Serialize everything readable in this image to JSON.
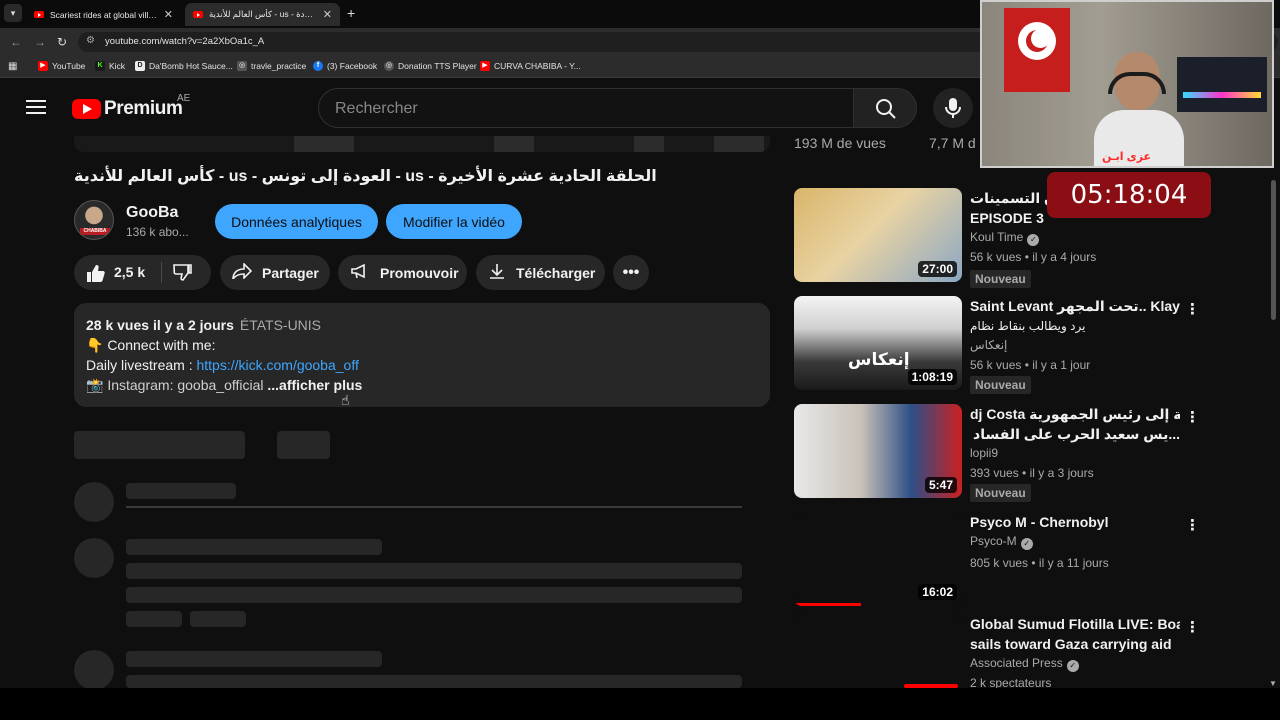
{
  "browser": {
    "tabs": [
      {
        "title": "Scariest rides at global village -",
        "active": false
      },
      {
        "title": "كأس العالم للأندية - us - العودة ||",
        "active": true
      }
    ],
    "url": "youtube.com/watch?v=2a2XbOa1c_A",
    "bookmarks": [
      "YouTube",
      "Kick",
      "Da'Bomb Hot Sauce...",
      "travle_practice",
      "(3) Facebook",
      "Donation TTS Player",
      "CURVA CHABIBA - Y..."
    ]
  },
  "header": {
    "logo_text": "Premium",
    "region": "AE",
    "search_placeholder": "Rechercher"
  },
  "video": {
    "title": "الحلقة الحادية عشرة الأخيرة - us - العودة إلى تونس - us - كأس العالم للأندية",
    "channel_name": "GooBa",
    "channel_subs": "136 k abo...",
    "avatar_tag": "CHABIBA",
    "analytics_label": "Données analytiques",
    "edit_label": "Modifier la vidéo",
    "likes": "2,5 k",
    "share_label": "Partager",
    "promote_label": "Promouvoir",
    "download_label": "Télécharger",
    "description": {
      "views_date": "28 k vues  il y a 2 jours",
      "country": "ÉTATS-UNIS",
      "line1": "👇 Connect with me:",
      "line2_prefix": "Daily livestream : ",
      "line2_link": "https://kick.com/gooba_off",
      "line3": "📸 Instagram: gooba_official ",
      "show_more": "...afficher plus"
    }
  },
  "sidebar": {
    "top_views_1": "193 M de vues",
    "top_views_2": "7,7 M d",
    "recommendations": [
      {
        "title_line1": "💗 ن التسمينات",
        "title_line2": "EPISODE 3",
        "channel": "Koul Time",
        "verified": true,
        "stats": "56 k vues • il y a 4 jours",
        "duration": "27:00",
        "badge": "Nouveau"
      },
      {
        "title_line1": "Saint Levant تحت المجهر.. Klay bbj",
        "title_line2": "يرد ويطالب بنقاط نظام",
        "channel": "إنعكاس",
        "verified": false,
        "stats": "56 k vues • il y a 1 jour",
        "duration": "1:08:19",
        "badge": "Nouveau",
        "thumb_text": "إنعكاس"
      },
      {
        "title_line1": "dj Costa يوجه رسالة إلى رئيس الجمهورية",
        "title_line2": "...يس سعيد الحرب على الفساد تبدأ بحماية من",
        "channel": "lopii9",
        "verified": false,
        "stats": "393 vues • il y a 3 jours",
        "duration": "5:47",
        "badge": "Nouveau"
      },
      {
        "title_line1": "Psyco M -  Chernobyl",
        "title_line2": "",
        "channel": "Psyco-M",
        "verified": true,
        "stats": "805 k vues • il y a 11 jours",
        "duration": "16:02",
        "badge": "",
        "progress": 0.4
      },
      {
        "title_line1": "Global Sumud Flotilla LIVE: Boat",
        "title_line2": "sails toward Gaza carrying aid",
        "channel": "Associated Press",
        "verified": true,
        "stats": "2 k spectateurs",
        "duration": "",
        "badge": ""
      }
    ]
  },
  "overlay": {
    "timer": "05:18:04",
    "webcam_caption": "عزى ابـ‍ن"
  },
  "colors": {
    "youtube_red": "#ff0000",
    "link_blue": "#3ea6ff",
    "background": "#0f0f0f",
    "timer_bg": "#8a0e14"
  }
}
